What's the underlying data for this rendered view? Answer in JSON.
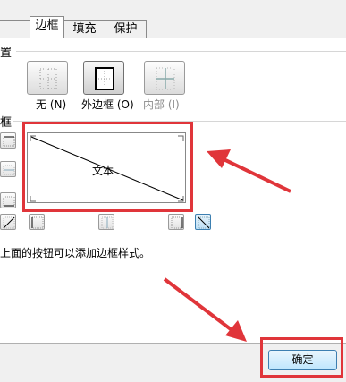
{
  "tabs": [
    {
      "label": ""
    },
    {
      "label": "边框"
    },
    {
      "label": "填充"
    },
    {
      "label": "保护"
    }
  ],
  "presets": {
    "section_label": "置",
    "none_label": "无 (N)",
    "outline_label": "外边框 (O)",
    "inside_label": "内部 (I)"
  },
  "border": {
    "section_label": "框",
    "preview_text": "文本"
  },
  "hint_text": "上面的按钮可以添加边框样式。",
  "footer": {
    "ok_label": "确定"
  },
  "colors": {
    "highlight": "#e0353a",
    "ok_border": "#3c7fb1"
  }
}
